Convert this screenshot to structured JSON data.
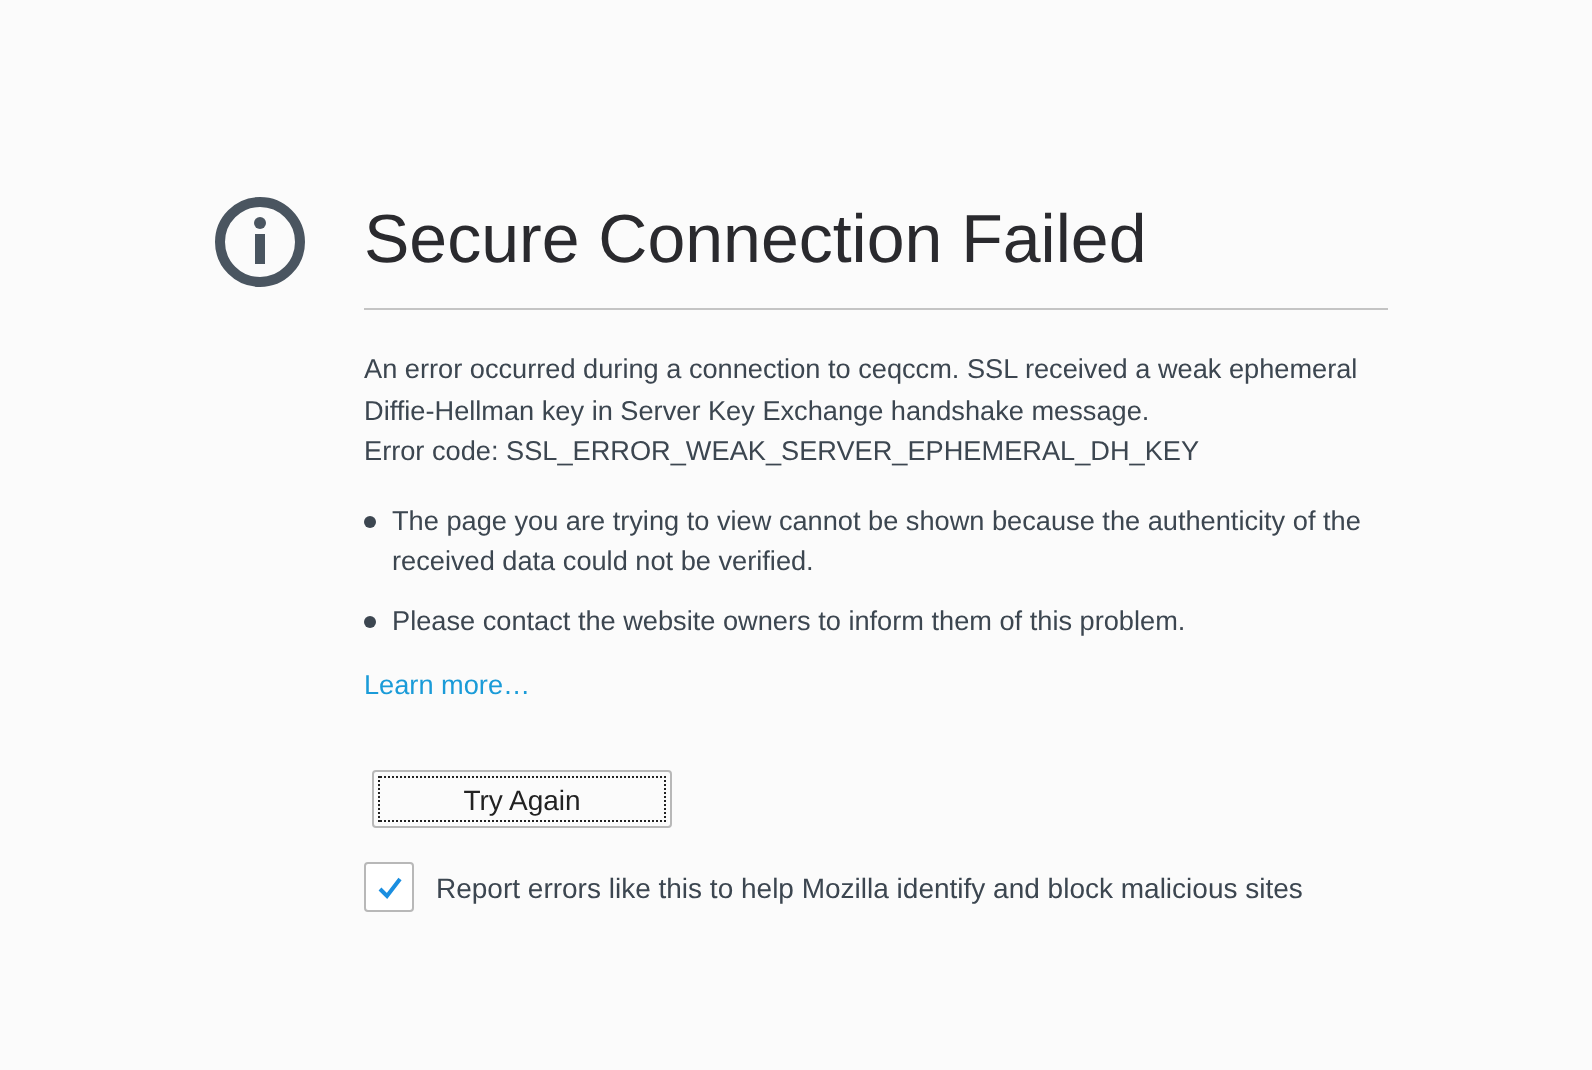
{
  "title": "Secure Connection Failed",
  "description": [
    "An error occurred during a connection to ceqccm. SSL received a weak ephemeral Diffie-Hellman key in Server Key Exchange handshake message.",
    "Error code: SSL_ERROR_WEAK_SERVER_EPHEMERAL_DH_KEY"
  ],
  "bullets": [
    "The page you are trying to view cannot be shown because the authenticity of the received data could not be verified.",
    "Please contact the website owners to inform them of this problem."
  ],
  "learn_more": "Learn more…",
  "button": "Try Again",
  "report": {
    "label": "Report errors like this to help Mozilla identify and block malicious sites",
    "checked": true
  }
}
